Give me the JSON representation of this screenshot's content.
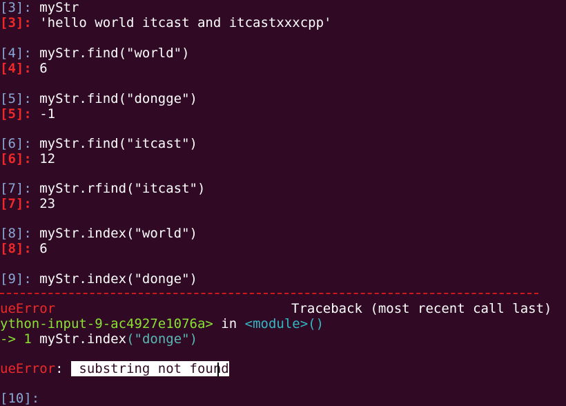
{
  "cells": [
    {
      "in_prompt": "[3]: ",
      "code": "myStr",
      "out_prompt": "[3]: ",
      "output": "'hello world itcast and itcastxxxcpp'"
    },
    {
      "in_prompt": "[4]: ",
      "code": "myStr.find(\"world\")",
      "out_prompt": "[4]: ",
      "output": "6"
    },
    {
      "in_prompt": "[5]: ",
      "code": "myStr.find(\"dongge\")",
      "out_prompt": "[5]: ",
      "output": "-1"
    },
    {
      "in_prompt": "[6]: ",
      "code": "myStr.find(\"itcast\")",
      "out_prompt": "[6]: ",
      "output": "12"
    },
    {
      "in_prompt": "[7]: ",
      "code": "myStr.rfind(\"itcast\")",
      "out_prompt": "[7]: ",
      "output": "23"
    },
    {
      "in_prompt": "[8]: ",
      "code": "myStr.index(\"world\")",
      "out_prompt": "[8]: ",
      "output": "6"
    },
    {
      "in_prompt": "[9]: ",
      "code": "myStr.index(\"donge\")"
    }
  ],
  "traceback": {
    "error_name_partial": "ueError",
    "header_right": "Traceback (most recent call last)",
    "input_ref": "ython-input-9-ac4927e1076a>",
    "in_word": " in ",
    "module": "<module>",
    "parens": "()",
    "arrow": "-> 1 ",
    "call_obj": "myStr",
    "call_dot": ".",
    "call_method": "index",
    "call_args_open": "(",
    "call_args_str": "\"donge\"",
    "call_args_close": ")",
    "error_line_name": "ueError",
    "error_colon": ": ",
    "error_message": " substring not found"
  },
  "next_prompt": "[10]: ",
  "colors": {
    "background": "#300a24",
    "in_prompt": "#8aa8d6",
    "out_prompt": "#ef2929",
    "traceback_rule": "#cc1a1a",
    "module": "#34b8c4",
    "input_ref": "#8ae234"
  }
}
